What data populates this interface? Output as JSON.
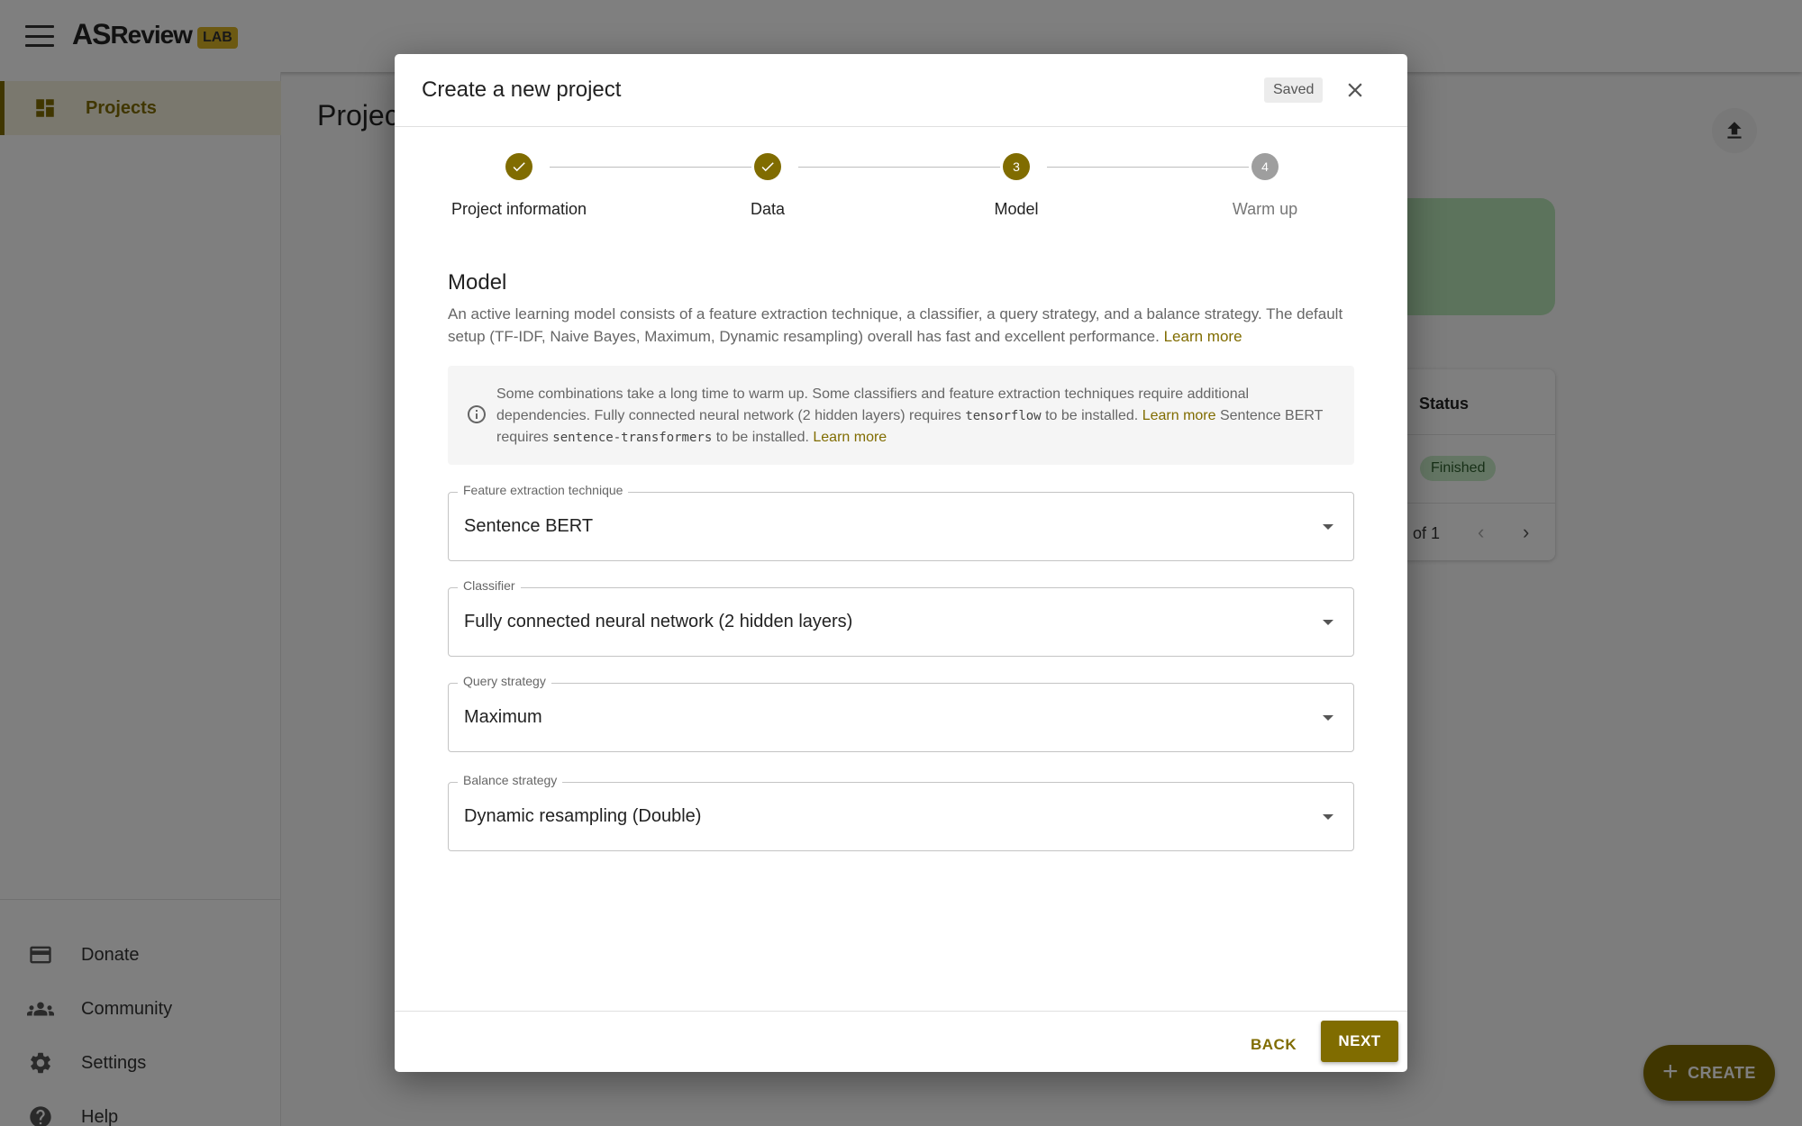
{
  "app": {
    "logo_as": "AS",
    "logo_review": "Review",
    "logo_lab": "LAB"
  },
  "sidebar": {
    "items": [
      {
        "label": "Projects",
        "icon": "dashboard-icon"
      },
      {
        "label": "Donate",
        "icon": "credit-card-icon"
      },
      {
        "label": "Community",
        "icon": "groups-icon"
      },
      {
        "label": "Settings",
        "icon": "gear-icon"
      },
      {
        "label": "Help",
        "icon": "help-icon"
      }
    ]
  },
  "background": {
    "page_title": "Projec",
    "table_header_status": "Status",
    "status_badge": "Finished",
    "pager_text": "of 1",
    "create_label": "CREATE"
  },
  "dialog": {
    "title": "Create a new project",
    "saved_label": "Saved",
    "steps": [
      {
        "label": "Project information",
        "state": "done"
      },
      {
        "label": "Data",
        "state": "done"
      },
      {
        "label": "Model",
        "state": "active",
        "number": "3"
      },
      {
        "label": "Warm up",
        "state": "todo",
        "number": "4"
      }
    ],
    "section_title": "Model",
    "section_desc": "An active learning model consists of a feature extraction technique, a classifier, a query strategy, and a balance strategy. The default setup (TF-IDF, Naive Bayes, Maximum, Dynamic resampling) overall has fast and excellent performance.",
    "learn_more": "Learn more",
    "info": {
      "part1": "Some combinations take a long time to warm up. Some classifiers and feature extraction techniques require additional dependencies. Fully connected neural network (2 hidden layers) requires",
      "code1": "tensorflow",
      "part2": "to be installed.",
      "link1": "Learn more",
      "part3": "Sentence BERT requires",
      "code2": "sentence-transformers",
      "part4": "to be installed.",
      "link2": "Learn more"
    },
    "fields": {
      "feature_extraction": {
        "label": "Feature extraction technique",
        "value": "Sentence BERT"
      },
      "classifier": {
        "label": "Classifier",
        "value": "Fully connected neural network (2 hidden layers)"
      },
      "query_strategy": {
        "label": "Query strategy",
        "value": "Maximum"
      },
      "balance_strategy": {
        "label": "Balance strategy",
        "value": "Dynamic resampling (Double)"
      }
    },
    "back_label": "BACK",
    "next_label": "NEXT"
  },
  "colors": {
    "accent": "#806c00",
    "logo_badge": "#d9b225",
    "status_finished_bg": "#c9ecc9"
  }
}
